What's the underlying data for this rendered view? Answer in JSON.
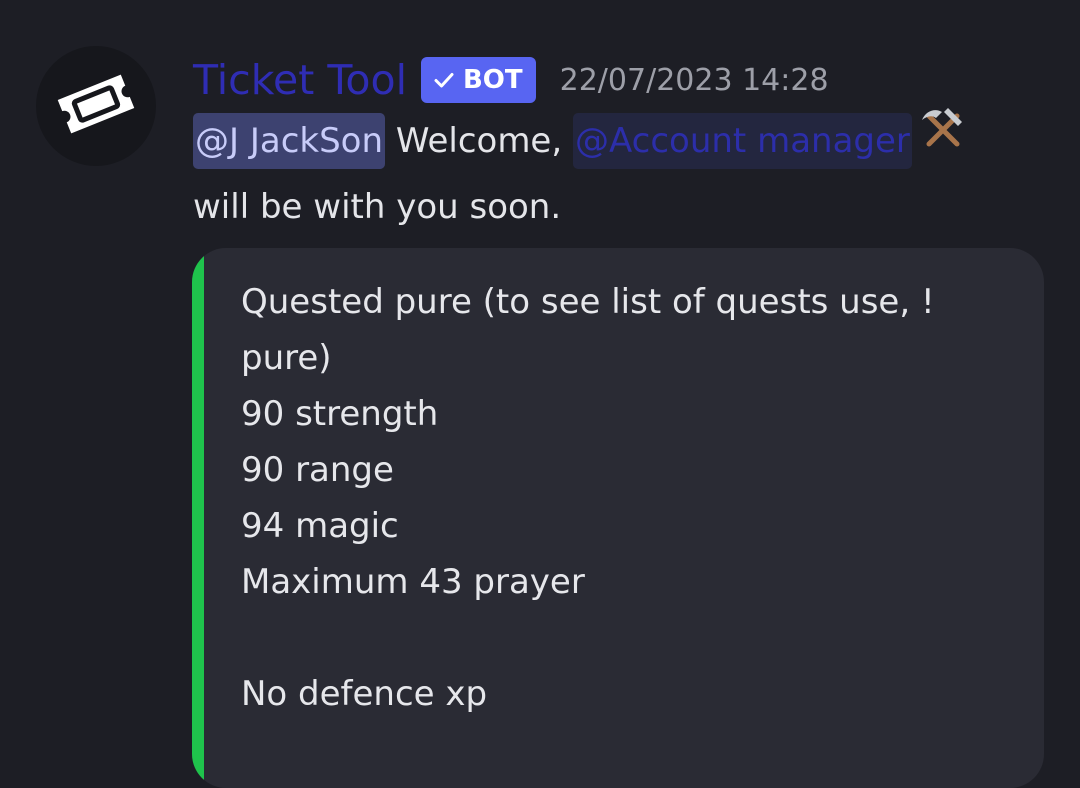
{
  "bot": {
    "username": "Ticket Tool",
    "tag": "BOT",
    "timestamp": "22/07/2023 14:28",
    "avatar_icon": "ticket-icon"
  },
  "message": {
    "user_mention": "@J JackSon",
    "welcome_text": "Welcome,",
    "role_mention": "@Account manager",
    "role_emoji": "hammer-and-pick-emoji",
    "suffix_text": "will be with you soon."
  },
  "embed": {
    "accent_color": "#1fc34c",
    "description": "Quested pure (to see list of quests use, !\npure)\n90 strength\n90 range\n94 magic\nMaximum 43 prayer\n\nNo defence xp"
  },
  "colors": {
    "background": "#1d1e25",
    "username": "#2f2db4",
    "bot_tag": "#5865f2",
    "timestamp": "#9d9fa8",
    "embed_background": "#2a2b34"
  }
}
